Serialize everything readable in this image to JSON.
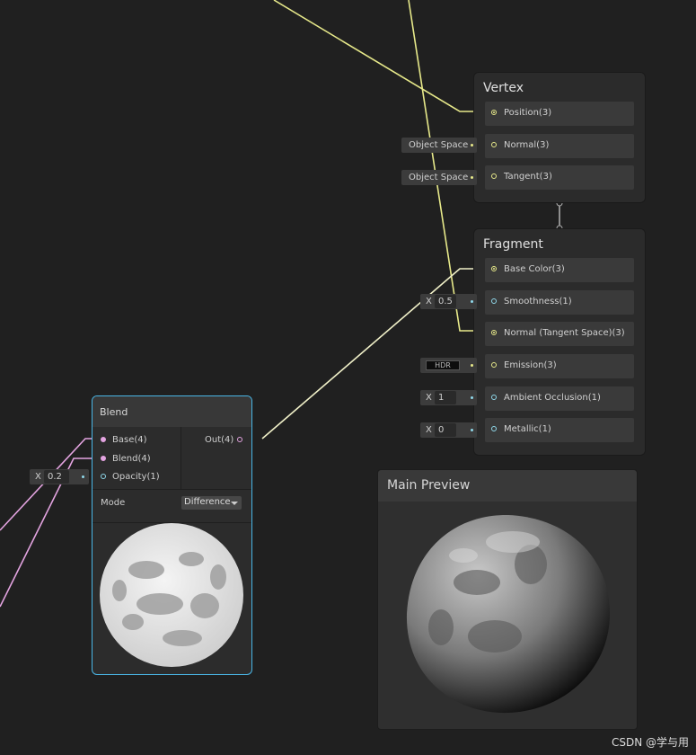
{
  "colors": {
    "position_wire": "#e7e98a",
    "float_wire": "#8fd8ea",
    "color_wire": "#e4a4e1",
    "selected_outline": "#4ab6e6"
  },
  "vertex": {
    "title": "Vertex",
    "slots": [
      {
        "label": "Position(3)",
        "port": "filled"
      },
      {
        "label": "Normal(3)",
        "port": "empty",
        "inline": "Object Space"
      },
      {
        "label": "Tangent(3)",
        "port": "empty",
        "inline": "Object Space"
      }
    ]
  },
  "fragment": {
    "title": "Fragment",
    "slots": [
      {
        "label": "Base Color(3)",
        "port": "filled"
      },
      {
        "label": "Smoothness(1)",
        "port": "empty",
        "inline_x": "X",
        "inline_value": "0.5"
      },
      {
        "label": "Normal (Tangent Space)(3)",
        "port": "filled"
      },
      {
        "label": "Emission(3)",
        "port": "empty",
        "inline": "HDR"
      },
      {
        "label": "Ambient Occlusion(1)",
        "port": "empty",
        "inline_x": "X",
        "inline_value": "1"
      },
      {
        "label": "Metallic(1)",
        "port": "empty",
        "inline_x": "X",
        "inline_value": "0"
      }
    ]
  },
  "blend": {
    "title": "Blend",
    "inputs": [
      {
        "label": "Base(4)"
      },
      {
        "label": "Blend(4)"
      },
      {
        "label": "Opacity(1)",
        "inline_x": "X",
        "inline_value": "0.2"
      }
    ],
    "output": "Out(4)",
    "mode_label": "Mode",
    "mode_value": "Difference",
    "preview_icon": "moon-texture-preview"
  },
  "main_preview": {
    "title": "Main Preview",
    "preview_icon": "shaded-moon-sphere"
  },
  "watermark": "CSDN @学与用"
}
